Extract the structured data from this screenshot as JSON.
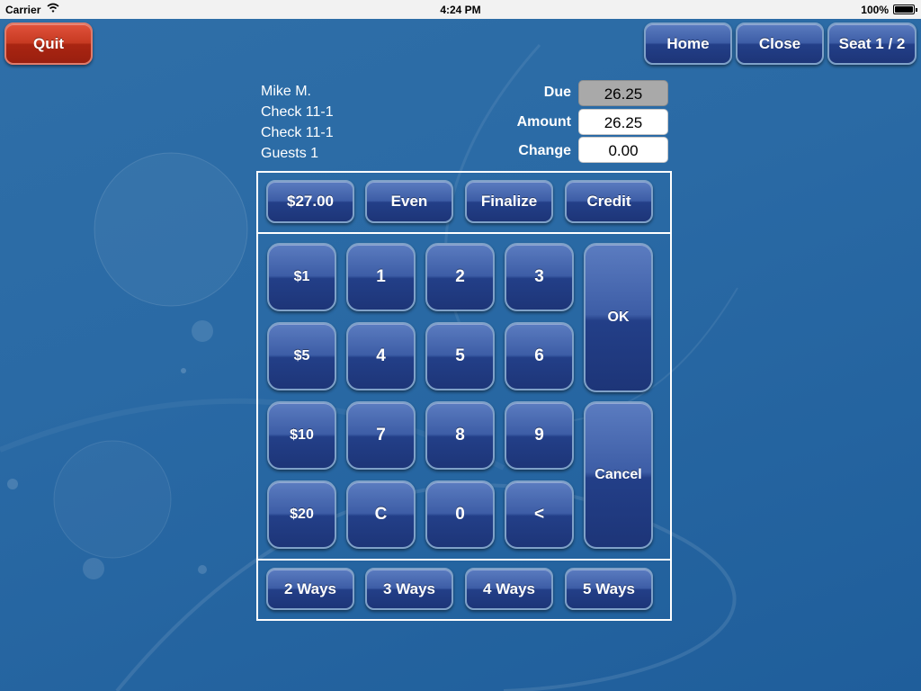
{
  "status_bar": {
    "carrier": "Carrier",
    "time": "4:24 PM",
    "battery": "100%"
  },
  "header": {
    "quit_label": "Quit",
    "home_label": "Home",
    "close_label": "Close",
    "seat_label": "Seat 1 / 2"
  },
  "info": {
    "server": "Mike M.",
    "check_1": "Check 11-1",
    "check_2": "Check 11-1",
    "guests": "Guests 1"
  },
  "fields": {
    "due_label": "Due",
    "due_value": "26.25",
    "amount_label": "Amount",
    "amount_value": "26.25",
    "change_label": "Change",
    "change_value": "0.00"
  },
  "quick_buttons": [
    "$27.00",
    "Even",
    "Finalize",
    "Credit"
  ],
  "keypad": {
    "cash": [
      "$1",
      "$5",
      "$10",
      "$20"
    ],
    "digits": [
      "1",
      "2",
      "3",
      "4",
      "5",
      "6",
      "7",
      "8",
      "9",
      "C",
      "0",
      "<"
    ],
    "ok_label": "OK",
    "cancel_label": "Cancel"
  },
  "split_buttons": [
    "2 Ways",
    "3 Ways",
    "4 Ways",
    "5 Ways"
  ],
  "colors": {
    "accent_blue": "#2a4f9a",
    "quit_red": "#c73a22",
    "background": "#2a6aa5"
  }
}
